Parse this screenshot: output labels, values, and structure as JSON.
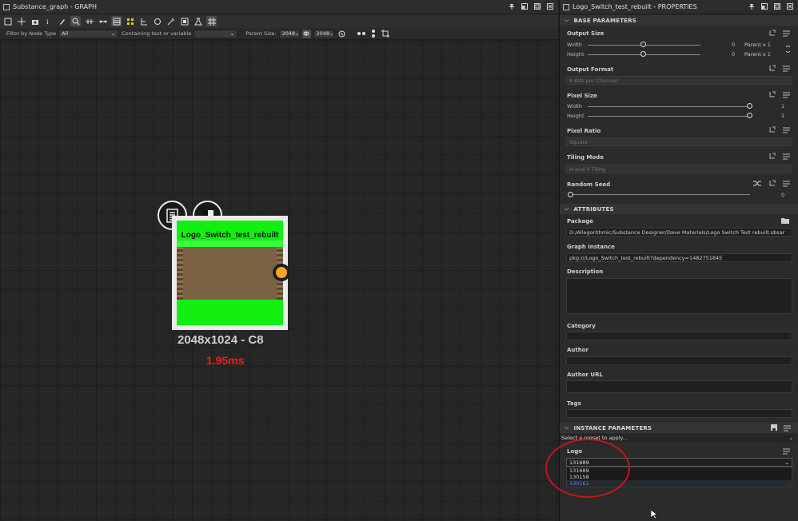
{
  "graph": {
    "title": "Substance_graph - GRAPH",
    "filter_label": "Filter by Node Type",
    "filter_value": "All",
    "containing_label": "Containing text or variable",
    "containing_value": "",
    "parent_size_label": "Parent Size:",
    "parent_size_value": "2048",
    "size_value": "2048"
  },
  "node": {
    "name": "Logo_Switch_test_rebuilt",
    "resolution": "2048x1024 - C8",
    "time": "1.95ms",
    "output_color": "#f5a623"
  },
  "properties": {
    "title": "Logo_Switch_test_rebuilt - PROPERTIES",
    "base_parameters": {
      "header": "BASE PARAMETERS",
      "output_size": {
        "label": "Output Size",
        "width_label": "Width",
        "width_value": "0",
        "width_mode": "Parent x 1",
        "height_label": "Height",
        "height_value": "0",
        "height_mode": "Parent x 1"
      },
      "output_format": {
        "label": "Output Format",
        "value": "8 Bits per Channel"
      },
      "pixel_size": {
        "label": "Pixel Size",
        "width_label": "Width",
        "width_value": "1",
        "height_label": "Height",
        "height_value": "1"
      },
      "pixel_ratio": {
        "label": "Pixel Ratio",
        "value": "Square"
      },
      "tiling_mode": {
        "label": "Tiling Mode",
        "value": "H and V Tiling"
      },
      "random_seed": {
        "label": "Random Seed",
        "value": "0"
      }
    },
    "attributes": {
      "header": "ATTRIBUTES",
      "package_label": "Package",
      "package_value": "D:/Allegorithmic/Substance Designer/Dave Materials/Logo Switch Test rebuilt.sbsar",
      "graph_instance_label": "Graph instance",
      "graph_instance_value": "pkg:///Logo_Switch_test_rebuilt?dependency=1482751845",
      "description_label": "Description",
      "category_label": "Category",
      "author_label": "Author",
      "author_url_label": "Author URL",
      "tags_label": "Tags"
    },
    "instance_parameters": {
      "header": "INSTANCE PARAMETERS",
      "preset_placeholder": "Select a preset to apply...",
      "logo_label": "Logo",
      "logo_value": "131689",
      "logo_options": [
        "131689",
        "130158",
        "130161"
      ]
    }
  }
}
